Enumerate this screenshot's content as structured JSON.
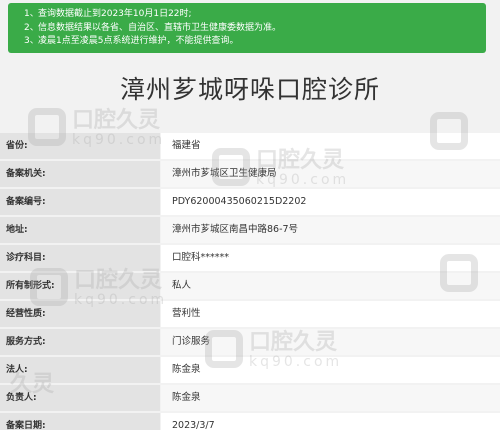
{
  "notice": {
    "lines": [
      {
        "num": "1、",
        "text": "查询数据截止到2023年10月1日22时;"
      },
      {
        "num": "2、",
        "text": "信息数据结果以各省、自治区、直辖市卫生健康委数据为准。"
      },
      {
        "num": "3、",
        "text": "凌晨1点至凌晨5点系统进行维护，不能提供查询。"
      }
    ]
  },
  "title": "漳州芗城呀哚口腔诊所",
  "records": [
    {
      "label": "省份:",
      "value": "福建省"
    },
    {
      "label": "备案机关:",
      "value": "漳州市芗城区卫生健康局"
    },
    {
      "label": "备案编号:",
      "value": "PDY62000435060215D2202"
    },
    {
      "label": "地址:",
      "value": "漳州市芗城区南昌中路86-7号"
    },
    {
      "label": "诊疗科目:",
      "value": "口腔科******"
    },
    {
      "label": "所有制形式:",
      "value": "私人"
    },
    {
      "label": "经营性质:",
      "value": "营利性"
    },
    {
      "label": "服务方式:",
      "value": "门诊服务"
    },
    {
      "label": "法人:",
      "value": "陈金泉"
    },
    {
      "label": "负责人:",
      "value": "陈金泉"
    },
    {
      "label": "备案日期:",
      "value": "2023/3/7"
    }
  ],
  "watermark": {
    "text": "口腔久灵",
    "sub": "kq90.com"
  }
}
